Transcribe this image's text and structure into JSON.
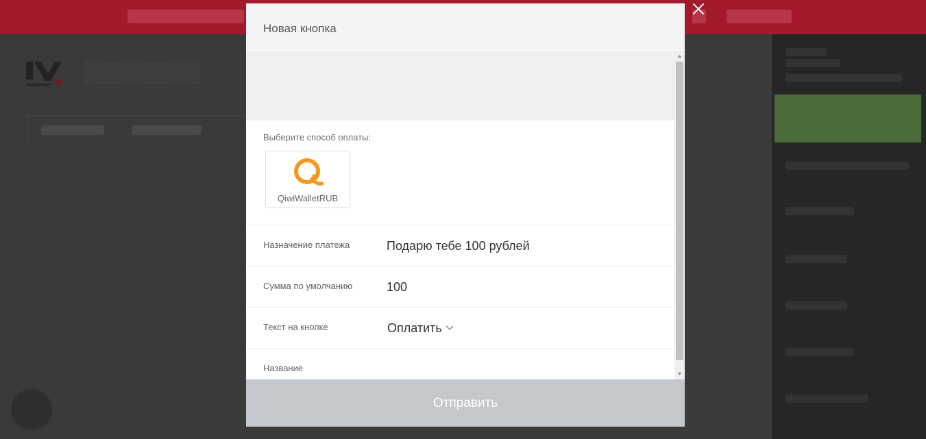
{
  "modal": {
    "title": "Новая кнопка",
    "payment_label": "Выберите способ оплаты:",
    "payment_method": {
      "name": "QiwiWalletRUB",
      "icon": "qiwi-icon",
      "color": "#f39a1e"
    },
    "fields": [
      {
        "label": "Назначение платежа",
        "value": "Подарю тебе 100 рублей"
      },
      {
        "label": "Сумма по умолчанию",
        "value": "100"
      },
      {
        "label": "Текст на кнопке",
        "value": "Оплатить"
      },
      {
        "label": "Название",
        "value": ""
      }
    ],
    "submit_label": "Отправить"
  },
  "colors": {
    "topbar": "#a31a2c",
    "submit": "#c4c7cb",
    "accent": "#f39a1e"
  }
}
